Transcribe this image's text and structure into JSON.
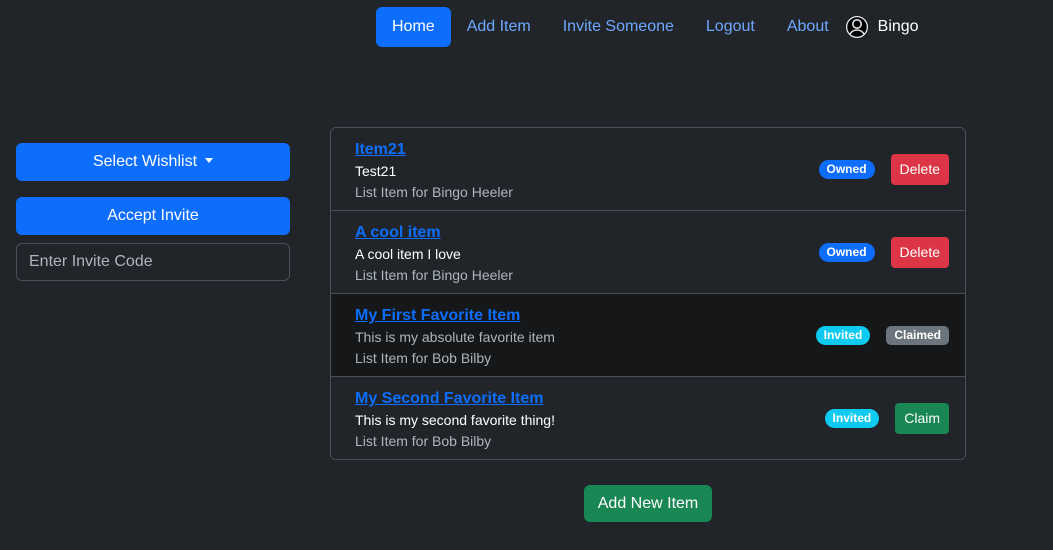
{
  "nav": {
    "home": "Home",
    "add_item": "Add Item",
    "invite_someone": "Invite Someone",
    "logout": "Logout",
    "about": "About",
    "user": "Bingo",
    "user_icon": "user-circle-icon"
  },
  "sidebar": {
    "select_wishlist": "Select Wishlist",
    "accept_invite": "Accept Invite",
    "invite_placeholder": "Enter Invite Code"
  },
  "items": [
    {
      "title": "Item21",
      "description": "Test21",
      "owner": "List Item for Bingo Heeler",
      "badge": "Owned",
      "action": "Delete"
    },
    {
      "title": "A cool item",
      "description": "A cool item I love",
      "owner": "List Item for Bingo Heeler",
      "badge": "Owned",
      "action": "Delete"
    },
    {
      "title": "My First Favorite Item",
      "description": "This is my absolute favorite item",
      "owner": "List Item for Bob Bilby",
      "badge": "Invited",
      "status": "Claimed"
    },
    {
      "title": "My Second Favorite Item",
      "description": "This is my second favorite thing!",
      "owner": "List Item for Bob Bilby",
      "badge": "Invited",
      "action": "Claim"
    }
  ],
  "add_new_item": "Add New Item",
  "colors": {
    "background": "#212529",
    "primary": "#0d6efd",
    "danger": "#dc3545",
    "success": "#198754",
    "info": "#0dcaf0",
    "secondary": "#6c757d"
  }
}
